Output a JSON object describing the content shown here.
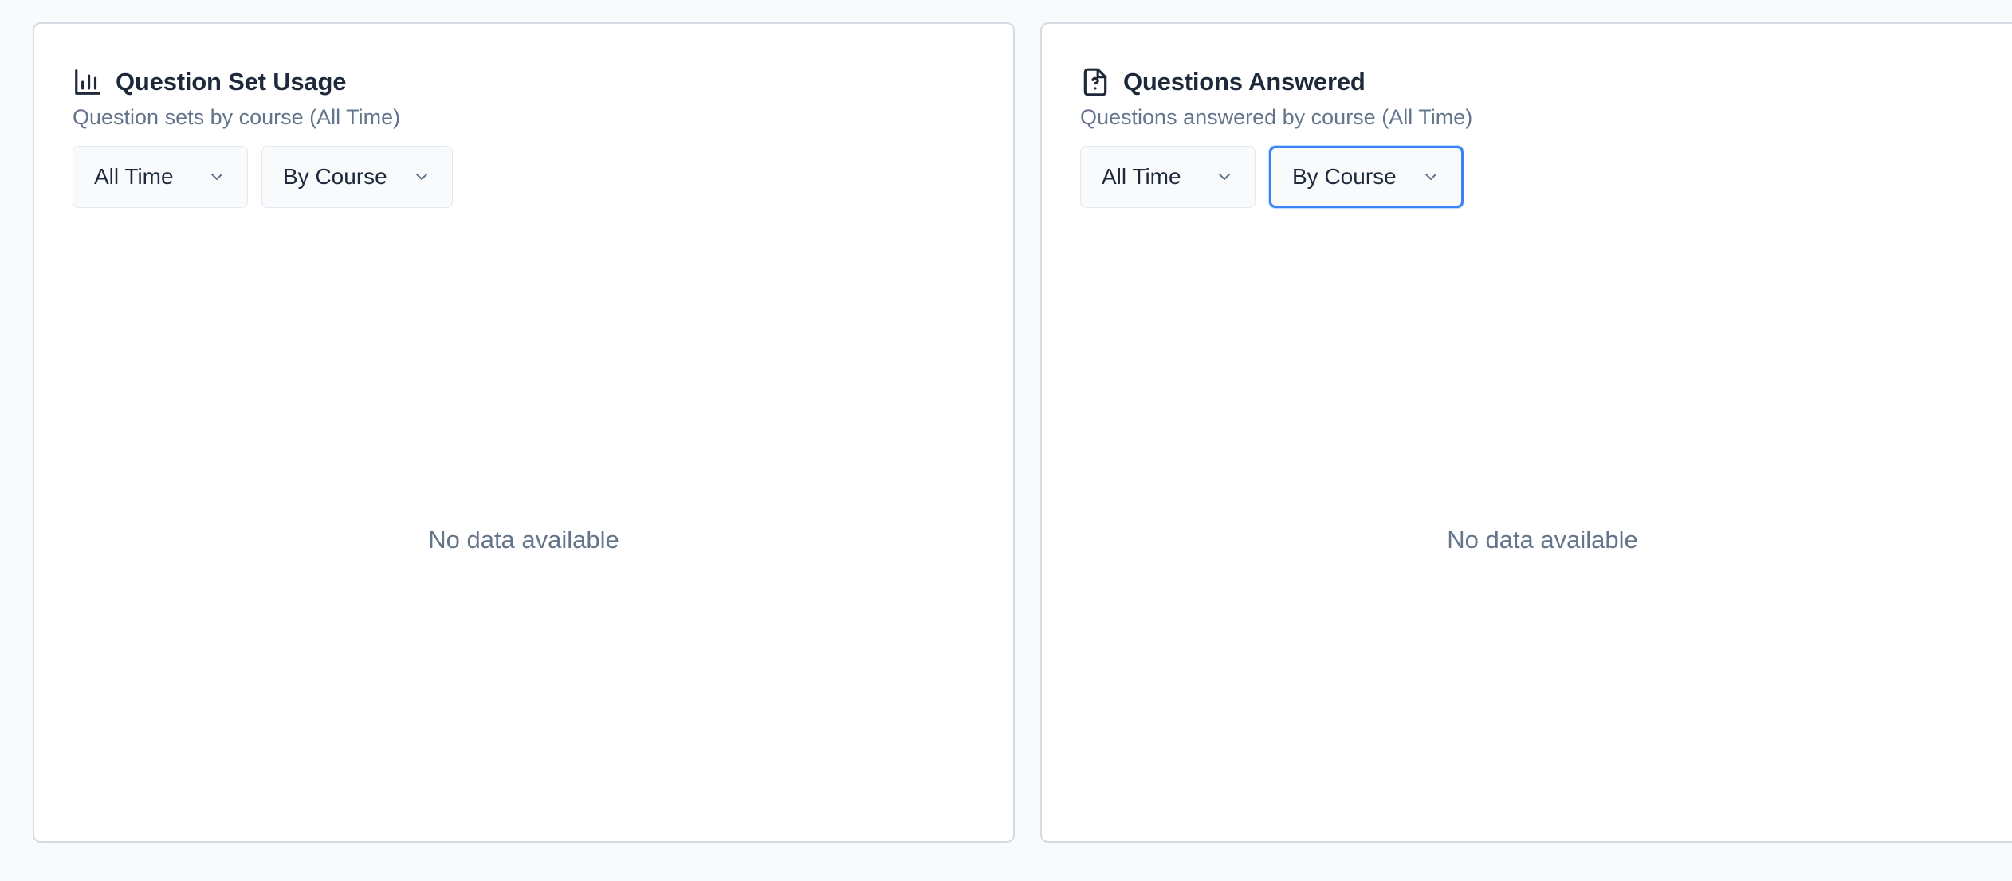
{
  "cards": [
    {
      "title": "Question Set Usage",
      "icon": "bar-chart-icon",
      "subtitle": "Question sets by course (All Time)",
      "filters": {
        "time": "All Time",
        "group": "By Course"
      },
      "empty_message": "No data available"
    },
    {
      "title": "Questions Answered",
      "icon": "file-question-icon",
      "subtitle": "Questions answered by course (All Time)",
      "filters": {
        "time": "All Time",
        "group": "By Course"
      },
      "empty_message": "No data available"
    }
  ],
  "colors": {
    "focus_ring": "#3b82f6",
    "title": "#1e293b",
    "muted": "#64748b",
    "border": "#d5dbe3"
  }
}
